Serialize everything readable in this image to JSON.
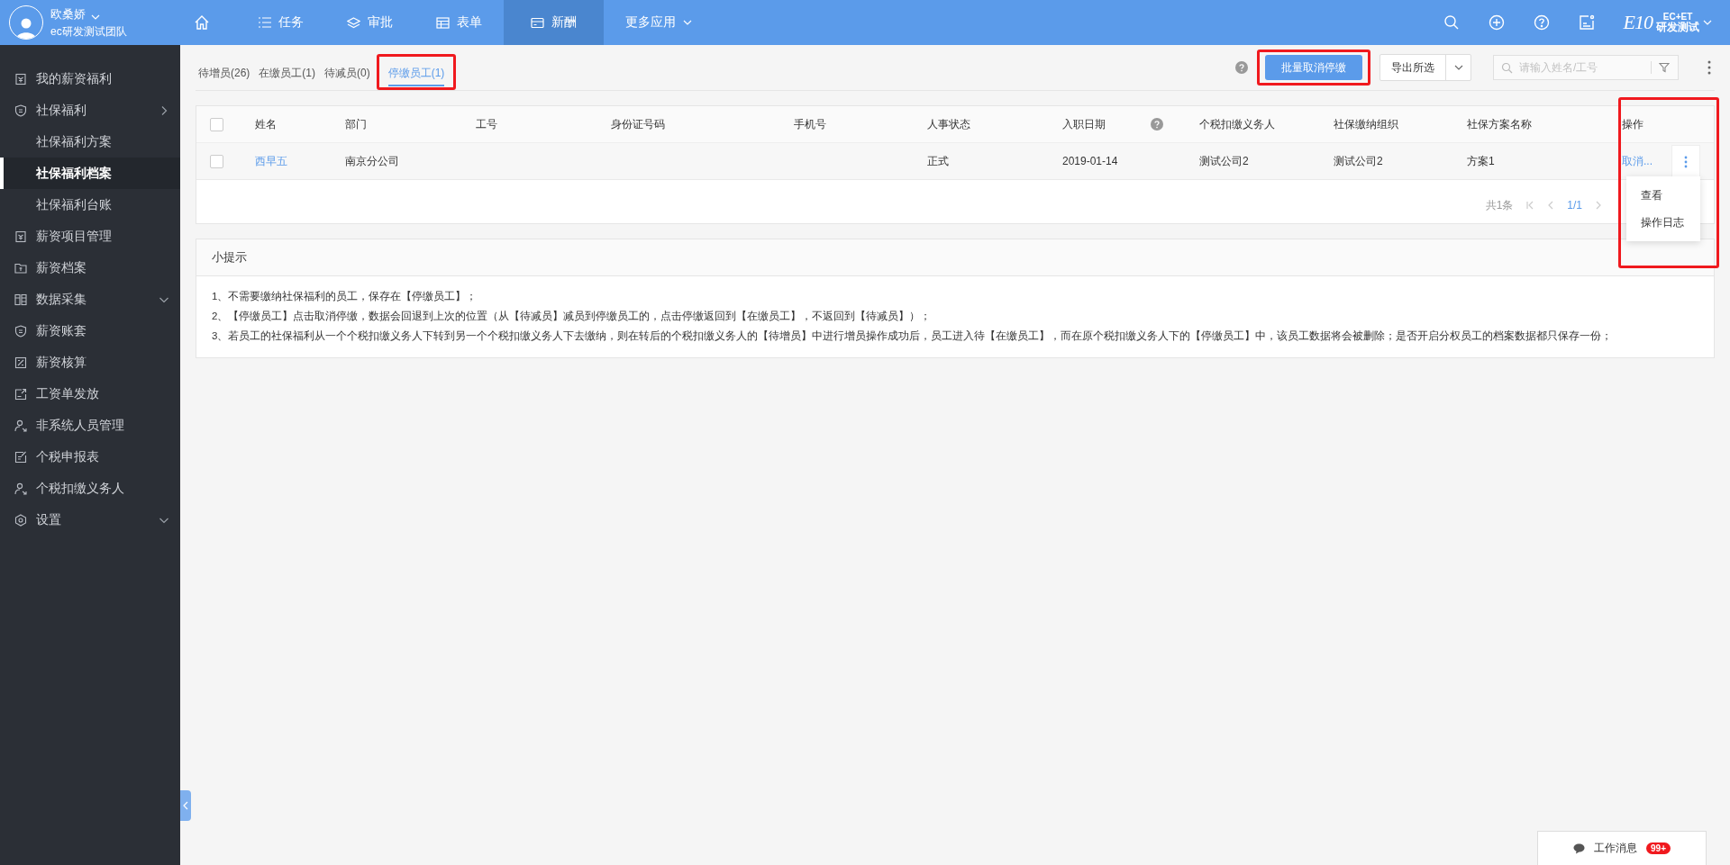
{
  "user": {
    "name": "欧桑娇",
    "team": "ec研发测试团队"
  },
  "nav": [
    {
      "kind": "home",
      "selected": false
    },
    {
      "kind": "tab",
      "label": "任务",
      "selected": false
    },
    {
      "kind": "tab",
      "label": "审批",
      "selected": false
    },
    {
      "kind": "tab",
      "label": "表单",
      "selected": false
    },
    {
      "kind": "tab",
      "label": "新酬",
      "selected": true
    },
    {
      "kind": "menu",
      "label": "更多应用",
      "selected": false
    }
  ],
  "logo": {
    "mark": "E10",
    "top": "EC+ET",
    "bottom": "研发测试"
  },
  "sidebar": [
    {
      "label": "我的薪资福利",
      "selected": false
    },
    {
      "label": "社保福利",
      "selected": false,
      "expanded": true,
      "children": [
        {
          "label": "社保福利方案",
          "selected": false
        },
        {
          "label": "社保福利档案",
          "selected": true
        },
        {
          "label": "社保福利台账",
          "selected": false
        }
      ]
    },
    {
      "label": "薪资项目管理",
      "selected": false
    },
    {
      "label": "薪资档案",
      "selected": false
    },
    {
      "label": "数据采集",
      "selected": false,
      "expanded": false
    },
    {
      "label": "薪资账套",
      "selected": false
    },
    {
      "label": "薪资核算",
      "selected": false
    },
    {
      "label": "工资单发放",
      "selected": false
    },
    {
      "label": "非系统人员管理",
      "selected": false
    },
    {
      "label": "个税申报表",
      "selected": false
    },
    {
      "label": "个税扣缴义务人",
      "selected": false
    },
    {
      "label": "设置",
      "selected": false,
      "expanded": false
    }
  ],
  "tabs": [
    {
      "label": "待增员(26)",
      "selected": false,
      "highlighted": false
    },
    {
      "label": "在缴员工(1)",
      "selected": false,
      "highlighted": false
    },
    {
      "label": "待减员(0)",
      "selected": false,
      "highlighted": false
    },
    {
      "label": "停缴员工(1)",
      "selected": true,
      "highlighted": true
    }
  ],
  "toolbar": {
    "primary": {
      "label": "批量取消停缴",
      "highlighted": true
    },
    "export": "导出所选",
    "search_placeholder": "请输入姓名/工号"
  },
  "table": {
    "all_checked": false,
    "columns": [
      {
        "label": "姓名"
      },
      {
        "label": "部门"
      },
      {
        "label": "工号"
      },
      {
        "label": "身份证号码"
      },
      {
        "label": "手机号"
      },
      {
        "label": "人事状态"
      },
      {
        "label": "入职日期"
      },
      {
        "label": "个税扣缴义务人"
      },
      {
        "label": "社保缴纳组织"
      },
      {
        "label": "社保方案名称"
      },
      {
        "label": "操作",
        "highlighted": true
      }
    ],
    "rows": [
      {
        "checked": false,
        "cells": [
          "西早五",
          "南京分公司",
          "",
          "",
          "",
          "正式",
          "2019-01-14",
          "测试公司2",
          "测试公司2",
          "方案1"
        ],
        "action": "取消..."
      }
    ],
    "menu": [
      "查看",
      "操作日志"
    ],
    "pagination": {
      "total": "共1条",
      "page": "1/1"
    }
  },
  "tips": {
    "title": "小提示",
    "lines": [
      "1、不需要缴纳社保福利的员工，保存在【停缴员工】；",
      "2、【停缴员工】点击取消停缴，数据会回退到上次的位置（从【待减员】减员到停缴员工的，点击停缴返回到【在缴员工】，不返回到【待减员】）；",
      "3、若员工的社保福利从一个个税扣缴义务人下转到另一个个税扣缴义务人下去缴纳，则在转后的个税扣缴义务人的【待增员】中进行增员操作成功后，员工进入待【在缴员工】，而在原个税扣缴义务人下的【停缴员工】中，该员工数据将会被删除；是否开启分权员工的档案数据都只保存一份；"
    ]
  },
  "messages": {
    "label": "工作消息",
    "badge": "99+"
  }
}
